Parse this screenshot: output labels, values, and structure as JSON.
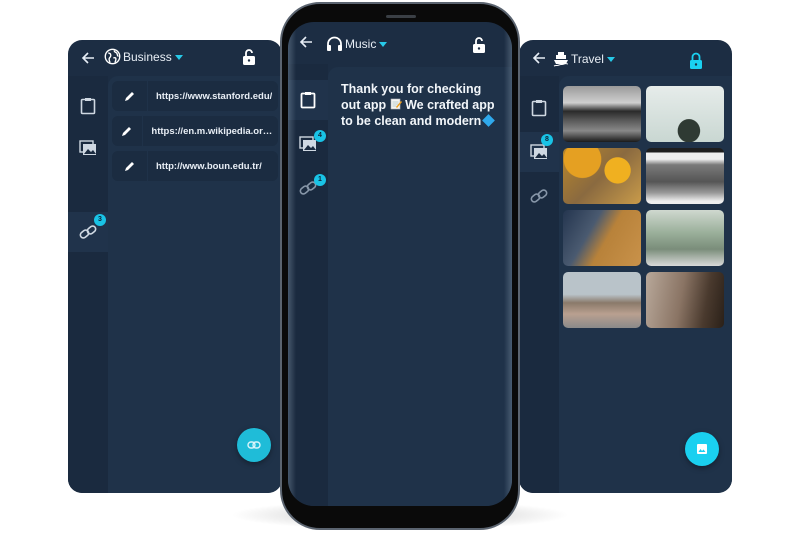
{
  "left_screen": {
    "category": "Business",
    "category_icon": "globe-icon",
    "lock_state": "unlocked",
    "rail": [
      {
        "name": "clipboard",
        "icon": "clipboard-icon",
        "badge": null,
        "active": false
      },
      {
        "name": "images",
        "icon": "images-icon",
        "badge": null,
        "active": false
      },
      {
        "name": "links",
        "icon": "link-icon",
        "badge": "3",
        "active": true
      }
    ],
    "links": [
      {
        "url": "https://www.stanford.edu/"
      },
      {
        "url": "https://en.m.wikipedia.org/wiki..."
      },
      {
        "url": "http://www.boun.edu.tr/"
      }
    ],
    "fab_icon": "link-icon"
  },
  "center_screen": {
    "category": "Music",
    "category_icon": "headphones-icon",
    "lock_state": "unlocked",
    "rail": [
      {
        "name": "clipboard",
        "icon": "clipboard-icon",
        "badge": null,
        "active": true
      },
      {
        "name": "images",
        "icon": "images-icon",
        "badge": "4",
        "active": false
      },
      {
        "name": "links",
        "icon": "link-icon",
        "badge": "1",
        "active": false
      }
    ],
    "note": {
      "part1": "Thank you for checking out app",
      "part2": " We crafted app to be clean and modern"
    }
  },
  "right_screen": {
    "category": "Travel",
    "category_icon": "ship-icon",
    "lock_state": "locked",
    "lock_color": "#1ad0f0",
    "rail": [
      {
        "name": "clipboard",
        "icon": "clipboard-icon",
        "badge": null,
        "active": false
      },
      {
        "name": "images",
        "icon": "images-icon",
        "badge": "8",
        "active": true
      },
      {
        "name": "links",
        "icon": "link-icon",
        "badge": null,
        "active": false
      }
    ],
    "images": [
      {
        "alt": "black and white pier over ocean"
      },
      {
        "alt": "misty skyscraper"
      },
      {
        "alt": "autumn leaves close-up"
      },
      {
        "alt": "blurred train in motion"
      },
      {
        "alt": "abstract orange and blue texture"
      },
      {
        "alt": "balcony with plant"
      },
      {
        "alt": "city skyline with spires"
      },
      {
        "alt": "street with bicycles"
      }
    ],
    "fab_icon": "image-icon"
  },
  "colors": {
    "accent": "#1fbcd8",
    "card_bg": "#1c2d43",
    "content_bg": "#1f3249"
  }
}
